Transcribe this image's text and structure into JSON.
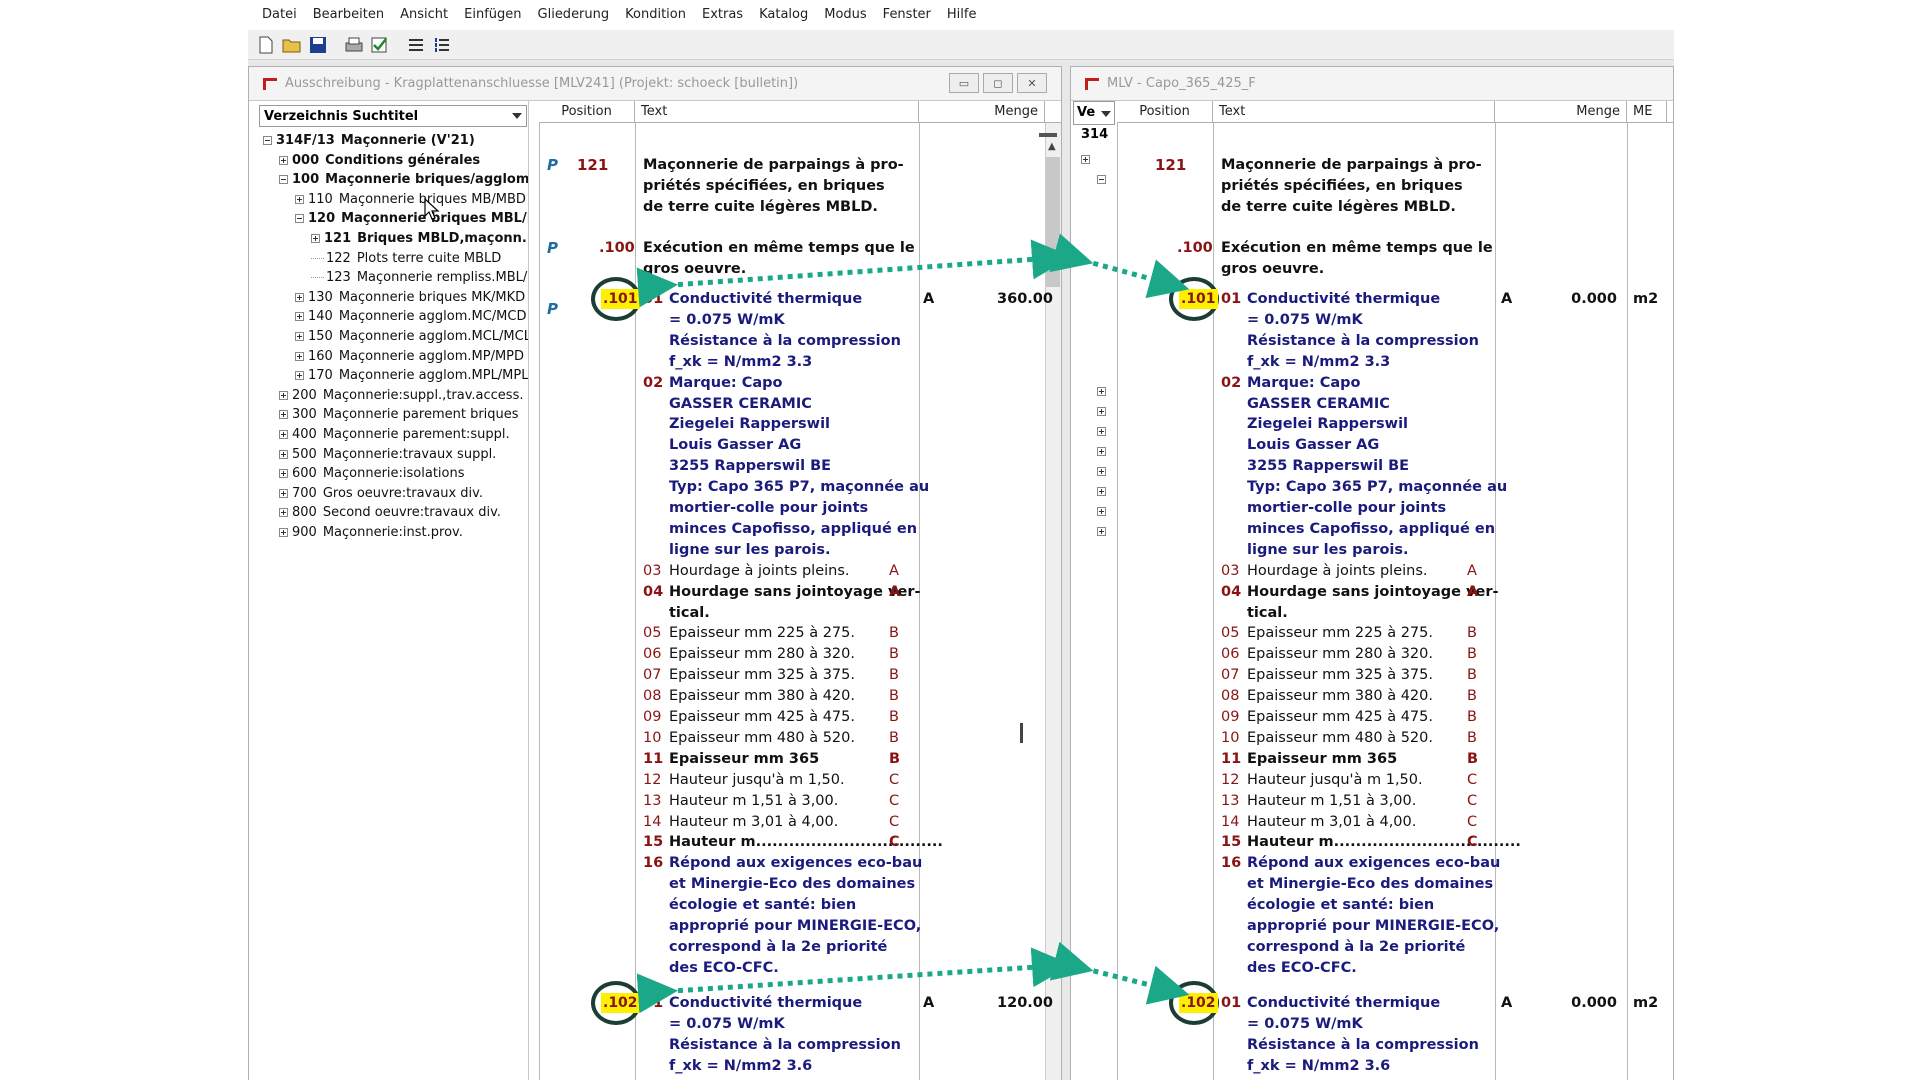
{
  "menu": [
    "Datei",
    "Bearbeiten",
    "Ansicht",
    "Einfügen",
    "Gliederung",
    "Kondition",
    "Extras",
    "Katalog",
    "Modus",
    "Fenster",
    "Hilfe"
  ],
  "toolbar": [
    "new-file-icon",
    "open-folder-icon",
    "save-icon",
    "print-icon",
    "check-icon",
    "list-icon",
    "numbered-list-icon"
  ],
  "left_window": {
    "title": "Ausschreibung - Kragplattenanschluesse [MLV241]  (Projekt: schoeck [bulletin])",
    "dropdown": "Verzeichnis Suchtitel",
    "tree": [
      {
        "code": "314F/13",
        "label": "Maçonnerie  (V'21)",
        "level": 0,
        "box": "minus",
        "bold": true
      },
      {
        "code": "000",
        "label": "Conditions générales",
        "level": 1,
        "box": "plus",
        "bold": true
      },
      {
        "code": "100",
        "label": "Maçonnerie briques/agglomérés",
        "level": 1,
        "box": "minus",
        "bold": true
      },
      {
        "code": "110",
        "label": "Maçonnerie briques MB/MBD",
        "level": 2,
        "box": "plus",
        "bold": false
      },
      {
        "code": "120",
        "label": "Maçonnerie briques MBL/MBI",
        "level": 2,
        "box": "minus",
        "bold": true
      },
      {
        "code": "121",
        "label": "Briques MBLD,maçonn.par",
        "level": 3,
        "box": "plus",
        "bold": true
      },
      {
        "code": "122",
        "label": "Plots terre cuite MBLD",
        "level": 3,
        "box": "none",
        "bold": false
      },
      {
        "code": "123",
        "label": "Maçonnerie rempliss.MBL/M",
        "level": 3,
        "box": "none",
        "bold": false
      },
      {
        "code": "130",
        "label": "Maçonnerie briques MK/MKD",
        "level": 2,
        "box": "plus",
        "bold": false
      },
      {
        "code": "140",
        "label": "Maçonnerie agglom.MC/MCD",
        "level": 2,
        "box": "plus",
        "bold": false
      },
      {
        "code": "150",
        "label": "Maçonnerie agglom.MCL/MCLI",
        "level": 2,
        "box": "plus",
        "bold": false
      },
      {
        "code": "160",
        "label": "Maçonnerie agglom.MP/MPD",
        "level": 2,
        "box": "plus",
        "bold": false
      },
      {
        "code": "170",
        "label": "Maçonnerie agglom.MPL/MPLD",
        "level": 2,
        "box": "plus",
        "bold": false
      },
      {
        "code": "200",
        "label": "Maçonnerie:suppl.,trav.access.",
        "level": 1,
        "box": "plus",
        "bold": false
      },
      {
        "code": "300",
        "label": "Maçonnerie parement briques",
        "level": 1,
        "box": "plus",
        "bold": false
      },
      {
        "code": "400",
        "label": "Maçonnerie parement:suppl.",
        "level": 1,
        "box": "plus",
        "bold": false
      },
      {
        "code": "500",
        "label": "Maçonnerie:travaux suppl.",
        "level": 1,
        "box": "plus",
        "bold": false
      },
      {
        "code": "600",
        "label": "Maçonnerie:isolations",
        "level": 1,
        "box": "plus",
        "bold": false
      },
      {
        "code": "700",
        "label": "Gros oeuvre:travaux div.",
        "level": 1,
        "box": "plus",
        "bold": false
      },
      {
        "code": "800",
        "label": "Second oeuvre:travaux div.",
        "level": 1,
        "box": "plus",
        "bold": false
      },
      {
        "code": "900",
        "label": "Maçonnerie:inst.prov.",
        "level": 1,
        "box": "plus",
        "bold": false
      }
    ],
    "headers": {
      "position": "Position",
      "text": "Text",
      "menge": "Menge"
    },
    "qty_101": "360.00",
    "qty_102": "120.00"
  },
  "right_window": {
    "title": "MLV - Capo_365_425_F",
    "dropdown": "Ve",
    "tree_stub": "314",
    "headers": {
      "position": "Position",
      "text": "Text",
      "menge": "Menge",
      "me": "ME"
    },
    "qty_101": "0.000",
    "qty_102": "0.000",
    "unit": "m2"
  },
  "doc": {
    "p_mark": "P",
    "pos_121": "121",
    "text_121": [
      "Maçonnerie de parpaings à pro-",
      "priétés spécifiées, en briques",
      "de terre cuite légères MBLD."
    ],
    "pos_100": ".100",
    "text_100": [
      "Exécution en même temps que le",
      "gros oeuvre."
    ],
    "pos_101": ".101",
    "pos_102": ".102",
    "qty_code": "A",
    "lines_101": [
      {
        "num": "01",
        "text": "Conductivité thermique",
        "style": "navy",
        "code": ""
      },
      {
        "num": "",
        "text": "= 0.075 W/mK",
        "style": "navy",
        "code": ""
      },
      {
        "num": "",
        "text": "Résistance à la compression",
        "style": "navy",
        "code": ""
      },
      {
        "num": "",
        "text": "f_xk = N/mm2 3.3",
        "style": "navy",
        "code": ""
      },
      {
        "num": "02",
        "text": "Marque: Capo",
        "style": "navy",
        "code": ""
      },
      {
        "num": "",
        "text": "GASSER CERAMIC",
        "style": "navy",
        "code": ""
      },
      {
        "num": "",
        "text": "Ziegelei Rapperswil",
        "style": "navy",
        "code": ""
      },
      {
        "num": "",
        "text": "Louis Gasser AG",
        "style": "navy",
        "code": ""
      },
      {
        "num": "",
        "text": "3255 Rapperswil BE",
        "style": "navy",
        "code": ""
      },
      {
        "num": "",
        "text": "Typ: Capo 365 P7, maçonnée au",
        "style": "navy",
        "code": ""
      },
      {
        "num": "",
        "text": "mortier-colle pour joints",
        "style": "navy",
        "code": ""
      },
      {
        "num": "",
        "text": "minces Capofisso, appliqué en",
        "style": "navy",
        "code": ""
      },
      {
        "num": "",
        "text": "ligne sur les parois.",
        "style": "navy",
        "code": ""
      },
      {
        "num": "03",
        "text": "Hourdage à joints pleins.",
        "style": "black",
        "code": "A"
      },
      {
        "num": "04",
        "text": "Hourdage sans jointoyage ver-",
        "style": "blk-b",
        "code": "A"
      },
      {
        "num": "",
        "text": "tical.",
        "style": "blk-b",
        "code": ""
      },
      {
        "num": "05",
        "text": "Epaisseur mm 225 à 275.",
        "style": "black",
        "code": "B"
      },
      {
        "num": "06",
        "text": "Epaisseur mm 280 à 320.",
        "style": "black",
        "code": "B"
      },
      {
        "num": "07",
        "text": "Epaisseur mm 325 à 375.",
        "style": "black",
        "code": "B"
      },
      {
        "num": "08",
        "text": "Epaisseur mm 380 à 420.",
        "style": "black",
        "code": "B"
      },
      {
        "num": "09",
        "text": "Epaisseur mm 425 à 475.",
        "style": "black",
        "code": "B"
      },
      {
        "num": "10",
        "text": "Epaisseur mm 480 à 520.",
        "style": "black",
        "code": "B"
      },
      {
        "num": "11",
        "text": "Epaisseur mm 365",
        "style": "blk-b",
        "code": "B"
      },
      {
        "num": "12",
        "text": "Hauteur jusqu'à m 1,50.",
        "style": "black",
        "code": "C"
      },
      {
        "num": "13",
        "text": "Hauteur m 1,51 à 3,00.",
        "style": "black",
        "code": "C"
      },
      {
        "num": "14",
        "text": "Hauteur m 3,01 à 4,00.",
        "style": "black",
        "code": "C"
      },
      {
        "num": "15",
        "text": "Hauteur m..................................",
        "style": "blk-b",
        "code": "C"
      },
      {
        "num": "16",
        "text": "Répond aux exigences eco-bau",
        "style": "navy",
        "code": ""
      },
      {
        "num": "",
        "text": "et Minergie-Eco des domaines",
        "style": "navy",
        "code": ""
      },
      {
        "num": "",
        "text": "écologie et santé: bien",
        "style": "navy",
        "code": ""
      },
      {
        "num": "",
        "text": "approprié pour MINERGIE-ECO,",
        "style": "navy",
        "code": ""
      },
      {
        "num": "",
        "text": "correspond à la 2e priorité",
        "style": "navy",
        "code": ""
      },
      {
        "num": "",
        "text": "des ECO-CFC.",
        "style": "navy",
        "code": ""
      }
    ],
    "lines_102": [
      {
        "num": "01",
        "text": "Conductivité thermique",
        "style": "navy",
        "code": ""
      },
      {
        "num": "",
        "text": "= 0.075 W/mK",
        "style": "navy",
        "code": ""
      },
      {
        "num": "",
        "text": "Résistance à la compression",
        "style": "navy",
        "code": ""
      },
      {
        "num": "",
        "text": "f_xk = N/mm2 3.6",
        "style": "navy",
        "code": ""
      }
    ]
  },
  "colors": {
    "navy": "#1b1b7e",
    "red": "#8a1414",
    "highlight": "#ffef00",
    "arrow": "#1aa889",
    "circle": "#1c3d34"
  }
}
